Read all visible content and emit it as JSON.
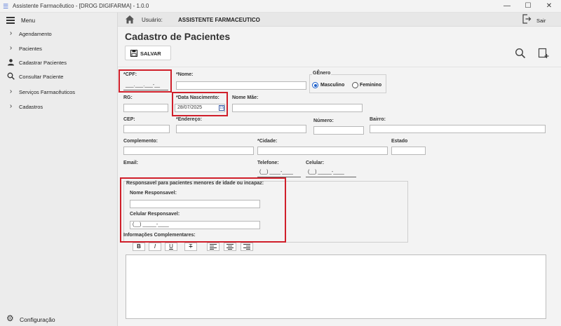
{
  "window": {
    "title": "Assistente Farmacêutico - [DROG DIGIFARMA] - 1.0.0",
    "minimize": "—",
    "maximize": "☐",
    "close": "✕"
  },
  "sidebar": {
    "menu_label": "Menu",
    "items": [
      {
        "label": "Agendamento",
        "icon": "chevron-right-icon"
      },
      {
        "label": "Pacientes",
        "icon": "chevron-right-icon"
      },
      {
        "label": "Cadastrar Pacientes",
        "icon": "person-icon"
      },
      {
        "label": "Consultar Paciente",
        "icon": "search-icon"
      },
      {
        "label": "Serviços Farmacêuticos",
        "icon": "chevron-right-icon"
      },
      {
        "label": "Cadastros",
        "icon": "chevron-right-icon"
      }
    ],
    "config_label": "Configuração"
  },
  "topbar": {
    "user_label": "Usuário:",
    "user_name": "ASSISTENTE FARMACEUTICO",
    "exit_label": "Sair"
  },
  "page": {
    "title": "Cadastro de Pacientes",
    "save_label": "SALVAR"
  },
  "form": {
    "cpf_label": "*CPF:",
    "cpf_value": "___.___.___-__",
    "nome_label": "*Nome:",
    "nome_value": "",
    "genero_label": "GÊnero",
    "masculino_label": "Masculino",
    "feminino_label": "Feminino",
    "rg_label": "RG:",
    "data_nasc_label": "*Data Nascimento:",
    "data_nasc_value": "28/07/2025",
    "nome_mae_label": "Nome Mãe:",
    "cep_label": "CEP:",
    "endereco_label": "*Endereço:",
    "numero_label": "Número:",
    "bairro_label": "Bairro:",
    "complemento_label": "Complemento:",
    "cidade_label": "*Cidade:",
    "estado_label": "Estado",
    "email_label": "Email:",
    "telefone_label": "Telefone:",
    "telefone_value": "(__) ____-____",
    "celular_label": "Celular:",
    "celular_value": "(__) _____-____",
    "responsavel_title": "Responsavel para pacientes menores de idade ou incapaz:",
    "nome_resp_label": "Nome Responsavel:",
    "celular_resp_label": "Celular Responsavel:",
    "celular_resp_value": "(__) _____-____",
    "info_label": "Informações Complementares:",
    "toolbar": {
      "bold": "B",
      "italic": "I",
      "underline": "U",
      "strike": "T"
    }
  },
  "colors": {
    "highlight": "#d01f2a",
    "radio_selected": "#1c5fc9"
  }
}
